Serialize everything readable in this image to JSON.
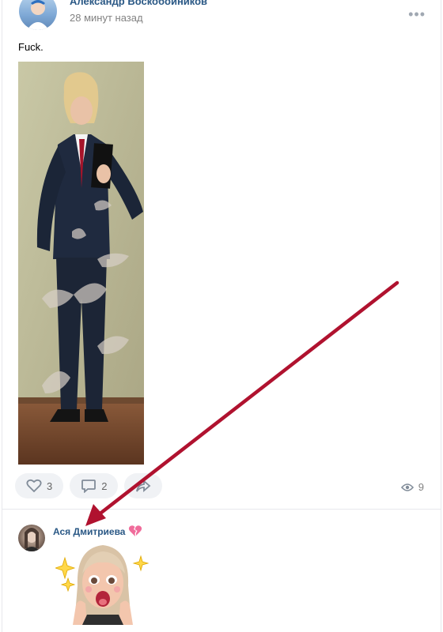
{
  "post": {
    "author": "Александр Воскобойников",
    "time": "28 минут назад",
    "text": "Fuck.",
    "likes": "3",
    "comments": "2",
    "views": "9"
  },
  "comment": {
    "author": "Ася Дмитриева"
  },
  "colors": {
    "link": "#2a5885",
    "arrow": "#b0122f",
    "button_bg": "#f0f2f5"
  }
}
